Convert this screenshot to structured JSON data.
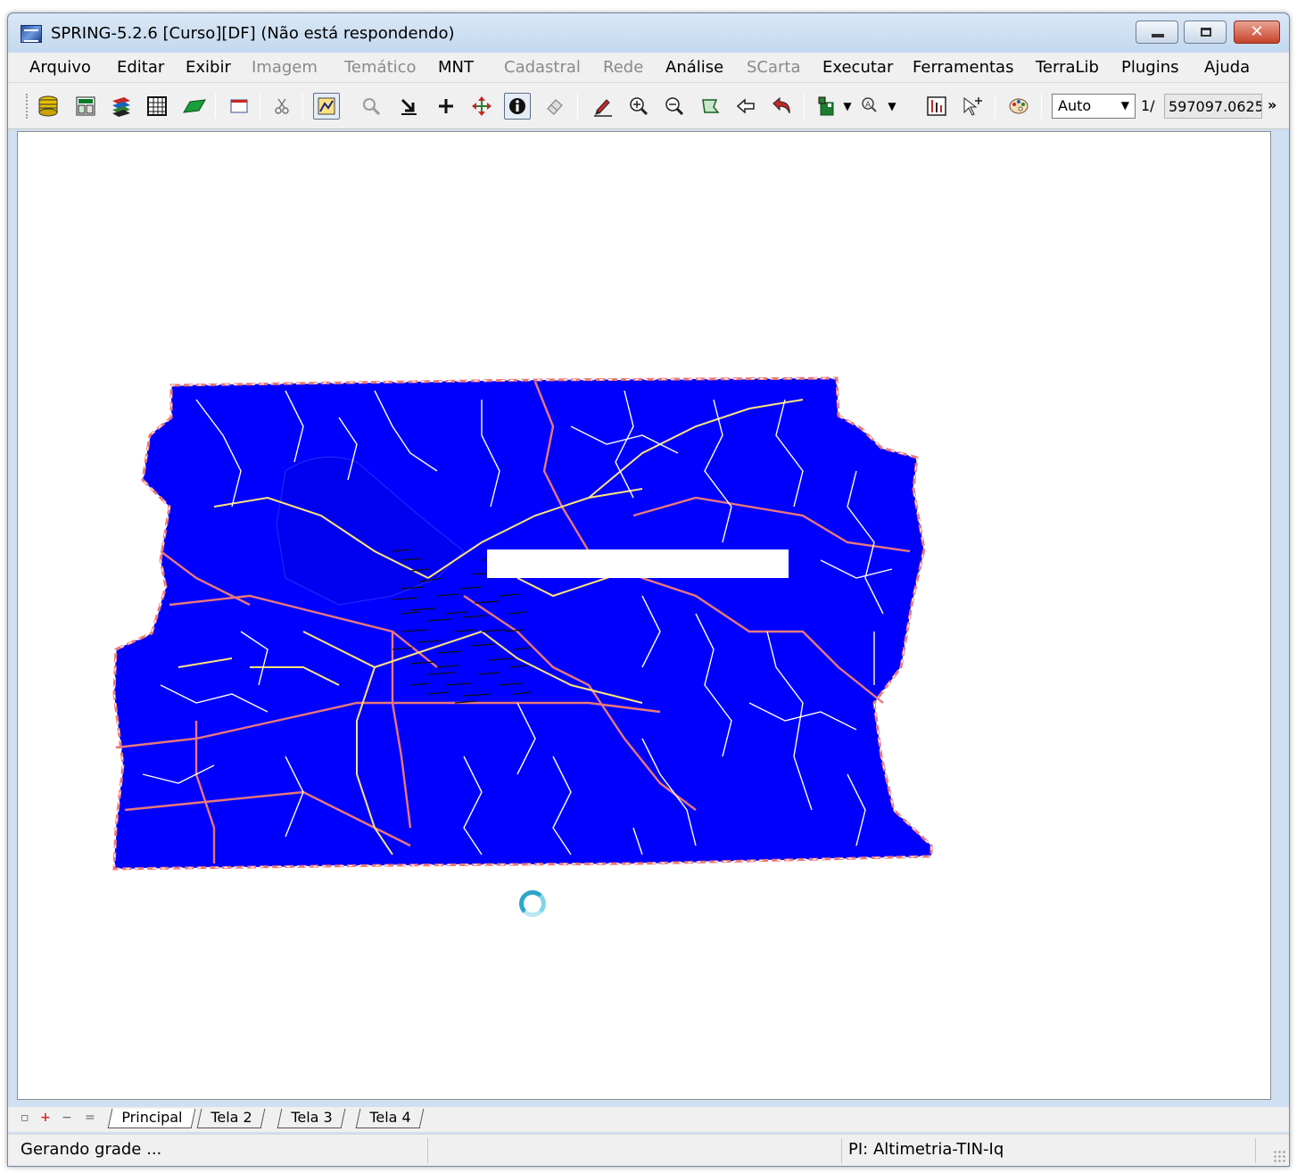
{
  "window": {
    "title": "SPRING-5.2.6 [Curso][DF] (Não está respondendo)",
    "controls": {
      "minimize": "",
      "maximize": "",
      "close": "✕"
    }
  },
  "menu": [
    {
      "label": "Arquivo",
      "enabled": true
    },
    {
      "label": "Editar",
      "enabled": true
    },
    {
      "label": "Exibir",
      "enabled": true
    },
    {
      "label": "Imagem",
      "enabled": false
    },
    {
      "label": "Temático",
      "enabled": false
    },
    {
      "label": "MNT",
      "enabled": true
    },
    {
      "label": "Cadastral",
      "enabled": false
    },
    {
      "label": "Rede",
      "enabled": false
    },
    {
      "label": "Análise",
      "enabled": true
    },
    {
      "label": "SCarta",
      "enabled": false
    },
    {
      "label": "Executar",
      "enabled": true
    },
    {
      "label": "Ferramentas",
      "enabled": true
    },
    {
      "label": "TerraLib",
      "enabled": true
    },
    {
      "label": "Plugins",
      "enabled": true
    },
    {
      "label": "Ajuda",
      "enabled": true
    }
  ],
  "toolbar": {
    "icons": [
      "database-icon",
      "layer-grid-icon",
      "stacked-layers-icon",
      "table-grid-icon",
      "parallelogram-icon",
      "window-icon",
      "scissors-icon",
      "draw-tool-icon",
      "magnifier-icon",
      "cursor-select-icon",
      "crosshair-icon",
      "pan-icon",
      "info-icon",
      "eraser-icon",
      "pencil-icon",
      "zoom-in-icon",
      "zoom-out-icon",
      "zoom-area-icon",
      "back-arrow-icon",
      "undo-icon",
      "display-layer-icon",
      "zoom-reference-icon",
      "histogram-icon",
      "pointer-plus-icon",
      "palette-icon"
    ],
    "scale_mode": "Auto",
    "scale_prefix": "1/",
    "scale_value": "597097.062500",
    "more": "»"
  },
  "canvas": {
    "colors": {
      "region": "#0000ff",
      "boundary": "#e8787a",
      "roads": "#ffe47a",
      "drainage": "#ffffff"
    }
  },
  "tabs": {
    "controls": [
      "▫",
      "+",
      "−",
      "="
    ],
    "items": [
      {
        "label": "Principal",
        "active": true
      },
      {
        "label": "Tela 2",
        "active": false
      },
      {
        "label": "Tela 3",
        "active": false
      },
      {
        "label": "Tela 4",
        "active": false
      }
    ]
  },
  "status": {
    "message": "Gerando grade ...",
    "plan": "PI: Altimetria-TIN-Iq"
  }
}
